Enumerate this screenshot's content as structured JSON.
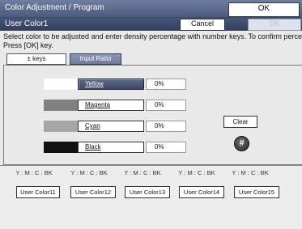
{
  "header": {
    "title": "Color Adjustment / Program",
    "ok_label": "OK"
  },
  "subheader": {
    "title": "User Color1",
    "cancel_label": "Cancel",
    "ok_label": "OK"
  },
  "instruction": {
    "line1": "Select color to be adjusted and enter density percentage with number keys.  To confirm percentage, press",
    "line2": "Press [OK] key."
  },
  "tabs": [
    {
      "label": "± keys",
      "active": false
    },
    {
      "label": "Input Ratio",
      "active": true
    }
  ],
  "colors": [
    {
      "label": "Yellow",
      "value": "0%",
      "swatch": "#ffffff",
      "selected": true
    },
    {
      "label": "Magenta",
      "value": "0%",
      "swatch": "#808080",
      "selected": false
    },
    {
      "label": "Cyan",
      "value": "0%",
      "swatch": "#a6a6a6",
      "selected": false
    },
    {
      "label": "Black",
      "value": "0%",
      "swatch": "#111111",
      "selected": false
    }
  ],
  "clear_label": "Clear",
  "hash_label": "#",
  "user_colors": [
    {
      "ratio": "Y : M : C : BK",
      "label": "User Color11"
    },
    {
      "ratio": "Y : M : C : BK",
      "label": "User Color12"
    },
    {
      "ratio": "Y : M : C : BK",
      "label": "User Color13"
    },
    {
      "ratio": "Y : M : C : BK",
      "label": "User Color14"
    },
    {
      "ratio": "Y : M : C : BK",
      "label": "User Color15"
    }
  ]
}
